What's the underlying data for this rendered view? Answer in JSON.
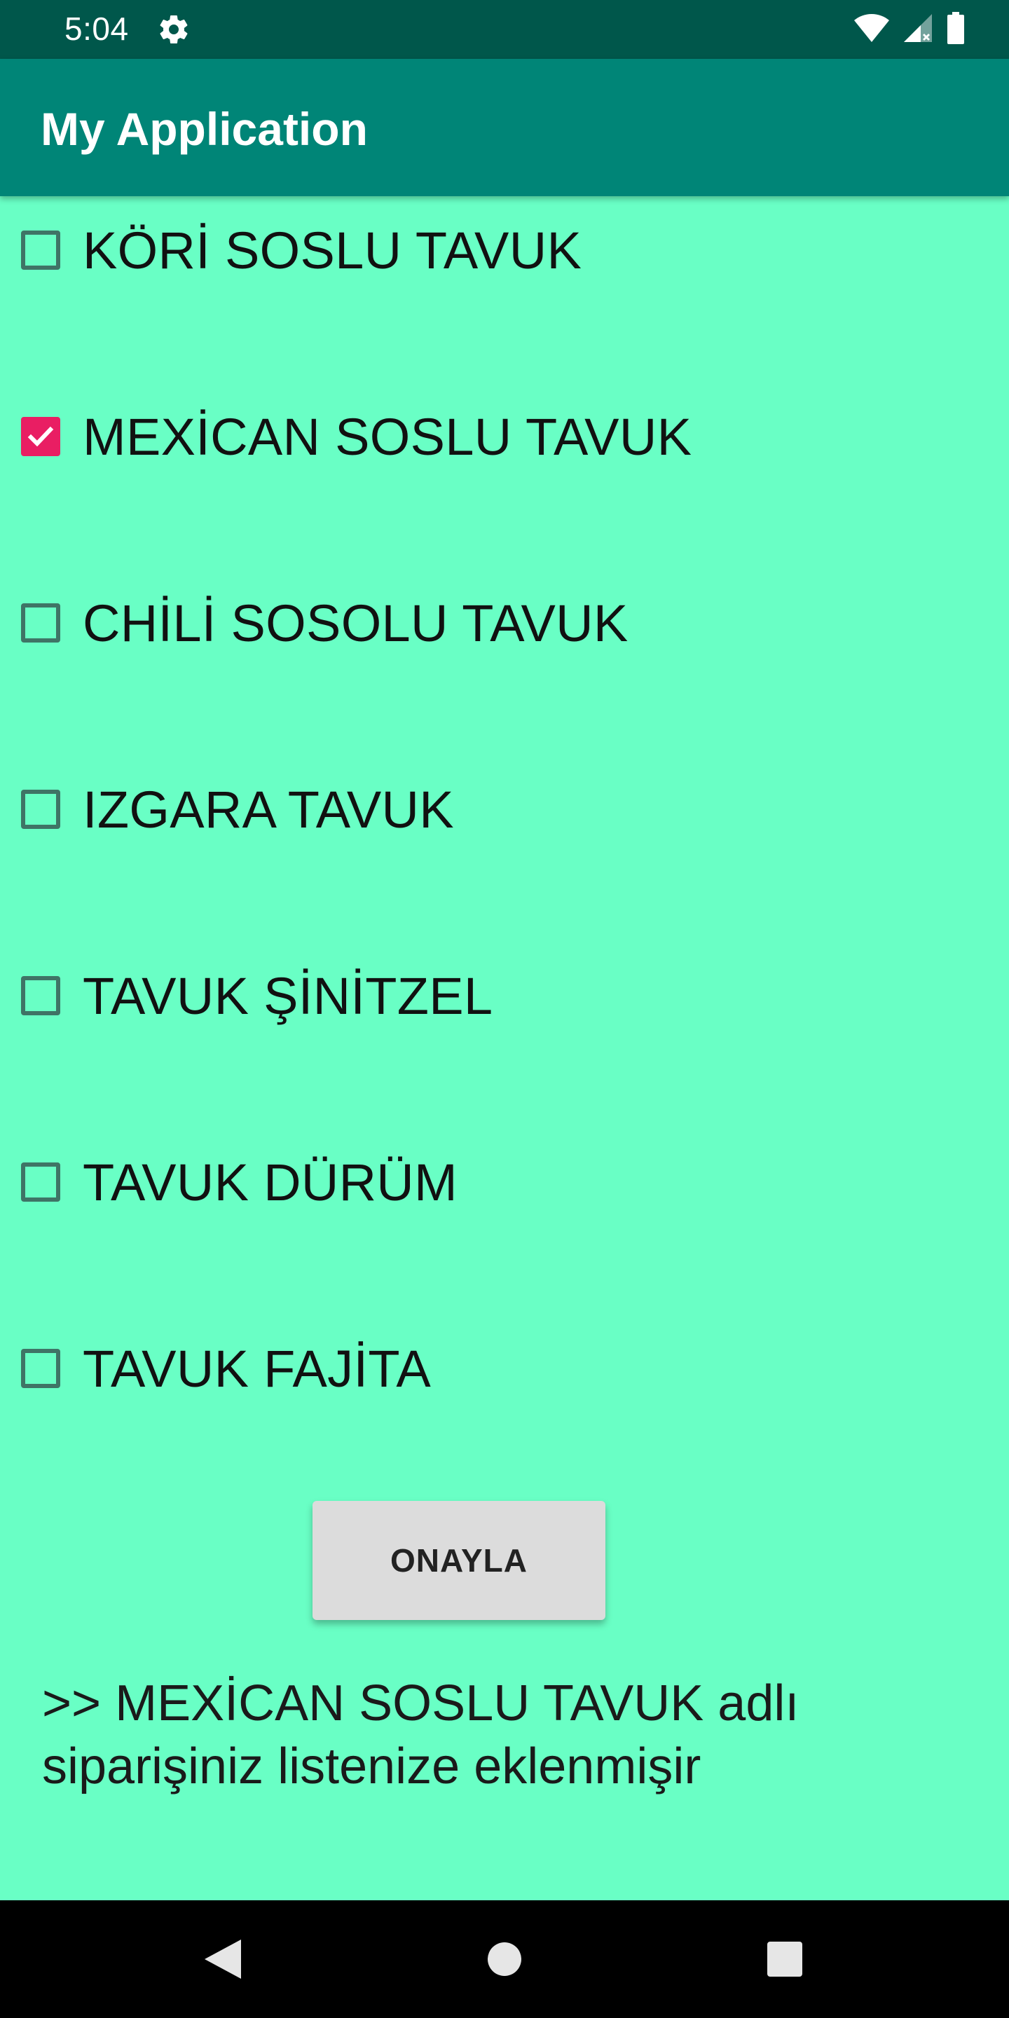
{
  "status_bar": {
    "time": "5:04",
    "icons": [
      "gear-icon",
      "wifi-icon",
      "signal-icon",
      "battery-icon"
    ]
  },
  "app_bar": {
    "title": "My Application"
  },
  "options": [
    {
      "label": "KÖRİ SOSLU TAVUK",
      "checked": false
    },
    {
      "label": "MEXİCAN SOSLU TAVUK",
      "checked": true
    },
    {
      "label": "CHİLİ SOSOLU TAVUK",
      "checked": false
    },
    {
      "label": "IZGARA TAVUK",
      "checked": false
    },
    {
      "label": "TAVUK ŞİNİTZEL",
      "checked": false
    },
    {
      "label": "TAVUK DÜRÜM",
      "checked": false
    },
    {
      "label": "TAVUK FAJİTA",
      "checked": false
    }
  ],
  "confirm_button": {
    "label": "ONAYLA"
  },
  "result_message": ">> MEXİCAN SOSLU TAVUK adlı siparişiniz listenize eklenmişir",
  "nav_bar": {
    "buttons": [
      "back-icon",
      "home-icon",
      "recents-icon"
    ]
  },
  "colors": {
    "background": "#69FFC5",
    "status_bar": "#00574B",
    "app_bar": "#008577",
    "checkbox_checked": "#E91E63",
    "checkbox_unchecked": "#3F7466"
  }
}
